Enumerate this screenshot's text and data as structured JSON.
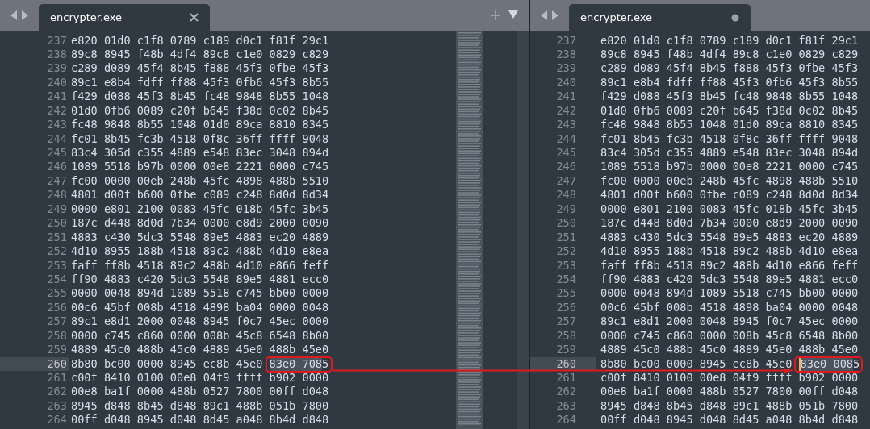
{
  "panes": [
    {
      "tab": {
        "title": "encrypter.exe",
        "modified": false
      },
      "tab_controls": true,
      "minimap": true,
      "lines": [
        {
          "number": "237",
          "text": "e820 01d0 c1f8 0789 c189 d0c1 f81f 29c1",
          "current": false
        },
        {
          "number": "238",
          "text": "89c8 8945 f48b 4df4 89c8 c1e0 0829 c829",
          "current": false
        },
        {
          "number": "239",
          "text": "c289 d089 45f4 8b45 f888 45f3 0fbe 45f3",
          "current": false
        },
        {
          "number": "240",
          "text": "89c1 e8b4 fdff ff88 45f3 0fb6 45f3 8b55",
          "current": false
        },
        {
          "number": "241",
          "text": "f429 d088 45f3 8b45 fc48 9848 8b55 1048",
          "current": false
        },
        {
          "number": "242",
          "text": "01d0 0fb6 0089 c20f b645 f38d 0c02 8b45",
          "current": false
        },
        {
          "number": "243",
          "text": "fc48 9848 8b55 1048 01d0 89ca 8810 8345",
          "current": false
        },
        {
          "number": "244",
          "text": "fc01 8b45 fc3b 4518 0f8c 36ff ffff 9048",
          "current": false
        },
        {
          "number": "245",
          "text": "83c4 305d c355 4889 e548 83ec 3048 894d",
          "current": false
        },
        {
          "number": "246",
          "text": "1089 5518 b97b 0000 00e8 2221 0000 c745",
          "current": false
        },
        {
          "number": "247",
          "text": "fc00 0000 00eb 248b 45fc 4898 488b 5510",
          "current": false
        },
        {
          "number": "248",
          "text": "4801 d00f b600 0fbe c089 c248 8d0d 8d34",
          "current": false
        },
        {
          "number": "249",
          "text": "0000 e801 2100 0083 45fc 018b 45fc 3b45",
          "current": false
        },
        {
          "number": "250",
          "text": "187c d448 8d0d 7b34 0000 e8d9 2000 0090",
          "current": false
        },
        {
          "number": "251",
          "text": "4883 c430 5dc3 5548 89e5 4883 ec20 4889",
          "current": false
        },
        {
          "number": "252",
          "text": "4d10 8955 188b 4518 89c2 488b 4d10 e8ea",
          "current": false
        },
        {
          "number": "253",
          "text": "faff ff8b 4518 89c2 488b 4d10 e866 feff",
          "current": false
        },
        {
          "number": "254",
          "text": "ff90 4883 c420 5dc3 5548 89e5 4881 ecc0",
          "current": false
        },
        {
          "number": "255",
          "text": "0000 0048 894d 1089 5518 c745 bb00 0000",
          "current": false
        },
        {
          "number": "256",
          "text": "00c6 45bf 008b 4518 4898 ba04 0000 0048",
          "current": false
        },
        {
          "number": "257",
          "text": "89c1 e8d1 2000 0048 8945 f0c7 45ec 0000",
          "current": false
        },
        {
          "number": "258",
          "text": "0000 c745 c860 0000 008b 45c8 6548 8b00",
          "current": false
        },
        {
          "number": "259",
          "text": "4889 45c0 488b 45c0 4889 45e0 488b 45e0",
          "current": false
        },
        {
          "number": "260",
          "text": "8b80 bc00 0000 8945 ec8b 45e0 ",
          "selection": "83e0 708",
          "after": "5",
          "cursor": false,
          "current": true
        },
        {
          "number": "261",
          "text": "c00f 8410 0100 00e8 04f9 ffff b902 0000",
          "current": false
        },
        {
          "number": "262",
          "text": "00e8 ba1f 0000 488b 0527 7800 00ff d048",
          "current": false
        },
        {
          "number": "263",
          "text": "8945 d848 8b45 d848 89c1 488b 051b 7800",
          "current": false
        },
        {
          "number": "264",
          "text": "00ff d048 8945 d048 8d45 a048 8b4d d848",
          "current": false
        }
      ]
    },
    {
      "tab": {
        "title": "encrypter.exe",
        "modified": true
      },
      "tab_controls": false,
      "minimap": false,
      "lines": [
        {
          "number": "237",
          "text": "e820 01d0 c1f8 0789 c189 d0c1 f81f 29c1",
          "current": false
        },
        {
          "number": "238",
          "text": "89c8 8945 f48b 4df4 89c8 c1e0 0829 c829",
          "current": false
        },
        {
          "number": "239",
          "text": "c289 d089 45f4 8b45 f888 45f3 0fbe 45f3",
          "current": false
        },
        {
          "number": "240",
          "text": "89c1 e8b4 fdff ff88 45f3 0fb6 45f3 8b55",
          "current": false
        },
        {
          "number": "241",
          "text": "f429 d088 45f3 8b45 fc48 9848 8b55 1048",
          "current": false
        },
        {
          "number": "242",
          "text": "01d0 0fb6 0089 c20f b645 f38d 0c02 8b45",
          "current": false
        },
        {
          "number": "243",
          "text": "fc48 9848 8b55 1048 01d0 89ca 8810 8345",
          "current": false
        },
        {
          "number": "244",
          "text": "fc01 8b45 fc3b 4518 0f8c 36ff ffff 9048",
          "current": false
        },
        {
          "number": "245",
          "text": "83c4 305d c355 4889 e548 83ec 3048 894d",
          "current": false
        },
        {
          "number": "246",
          "text": "1089 5518 b97b 0000 00e8 2221 0000 c745",
          "current": false
        },
        {
          "number": "247",
          "text": "fc00 0000 00eb 248b 45fc 4898 488b 5510",
          "current": false
        },
        {
          "number": "248",
          "text": "4801 d00f b600 0fbe c089 c248 8d0d 8d34",
          "current": false
        },
        {
          "number": "249",
          "text": "0000 e801 2100 0083 45fc 018b 45fc 3b45",
          "current": false
        },
        {
          "number": "250",
          "text": "187c d448 8d0d 7b34 0000 e8d9 2000 0090",
          "current": false
        },
        {
          "number": "251",
          "text": "4883 c430 5dc3 5548 89e5 4883 ec20 4889",
          "current": false
        },
        {
          "number": "252",
          "text": "4d10 8955 188b 4518 89c2 488b 4d10 e8ea",
          "current": false
        },
        {
          "number": "253",
          "text": "faff ff8b 4518 89c2 488b 4d10 e866 feff",
          "current": false
        },
        {
          "number": "254",
          "text": "ff90 4883 c420 5dc3 5548 89e5 4881 ecc0",
          "current": false
        },
        {
          "number": "255",
          "text": "0000 0048 894d 1089 5518 c745 bb00 0000",
          "current": false
        },
        {
          "number": "256",
          "text": "00c6 45bf 008b 4518 4898 ba04 0000 0048",
          "current": false
        },
        {
          "number": "257",
          "text": "89c1 e8d1 2000 0048 8945 f0c7 45ec 0000",
          "current": false
        },
        {
          "number": "258",
          "text": "0000 c745 c860 0000 008b 45c8 6548 8b00",
          "current": false
        },
        {
          "number": "259",
          "text": "4889 45c0 488b 45c0 4889 45e0 488b 45e0",
          "current": false
        },
        {
          "number": "260",
          "text": "8b80 bc00 0000 8945 ec8b 45e0 ",
          "selection": "83e0 008",
          "after": "5",
          "cursor": true,
          "current": true
        },
        {
          "number": "261",
          "text": "c00f 8410 0100 00e8 04f9 ffff b902 0000",
          "current": false
        },
        {
          "number": "262",
          "text": "00e8 ba1f 0000 488b 0527 7800 00ff d048",
          "current": false
        },
        {
          "number": "263",
          "text": "8945 d848 8b45 d848 89c1 488b 051b 7800",
          "current": false
        },
        {
          "number": "264",
          "text": "00ff d048 8945 d048 8d45 a048 8b4d d848",
          "current": false
        }
      ]
    }
  ]
}
